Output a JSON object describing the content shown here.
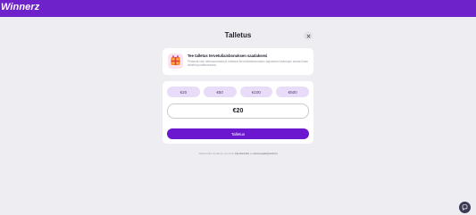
{
  "header": {
    "logo_text": "Winnerz"
  },
  "page": {
    "title": "Talletus"
  },
  "bonus": {
    "title": "Tee talletus tervetuliaisbonuksen saadaksesi",
    "description": "Pelaavat vain talletusrahasta ja voittavat tervetuliaisbonuksen tarjoamien lisäetujen kautta ilman lisäehtoja talletuksissa."
  },
  "deposit": {
    "amount_options": [
      "€20",
      "€50",
      "€100",
      "€500"
    ],
    "amount_value": "€20",
    "submit_label": "Talletus"
  },
  "footer": {
    "prefix": "Jatkamalla hyväksyt sivuston",
    "link1": "käyttöehdot",
    "middle": "ja",
    "link2": "tietosuojakäytännön"
  },
  "colors": {
    "brand": "#6e22c9",
    "button": "#6b16cf",
    "chip": "#e8dcf8"
  }
}
